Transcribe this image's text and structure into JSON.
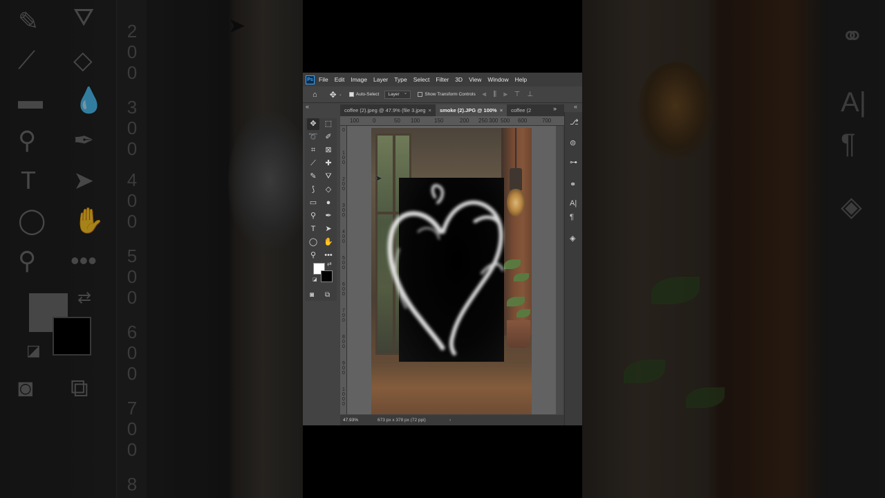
{
  "app": {
    "name": "Photoshop",
    "logo_text": "Ps"
  },
  "menu": [
    "File",
    "Edit",
    "Image",
    "Layer",
    "Type",
    "Select",
    "Filter",
    "3D",
    "View",
    "Window",
    "Help"
  ],
  "options_bar": {
    "auto_select_label": "Auto-Select",
    "auto_select_checked": true,
    "target_value": "Layer",
    "transform_controls_label": "Show Transform Controls",
    "transform_controls_checked": false
  },
  "tabs": [
    {
      "label": "coffee (2).jpeg @ 47.9% (file 3.jpeg",
      "active": false
    },
    {
      "label": "smoke (2).JPG @ 100%",
      "active": true
    },
    {
      "label": "coffee (2",
      "active": false
    }
  ],
  "ruler_top": [
    "100",
    "0",
    "50",
    "100",
    "150",
    "200",
    "250",
    "300",
    "500",
    "600",
    "700"
  ],
  "ruler_left": [
    "0",
    "1\n0\n0",
    "2\n0\n0",
    "3\n0\n0",
    "4\n0\n0",
    "5\n0\n0",
    "6\n0\n0",
    "7\n0\n0",
    "8\n0\n0",
    "9\n0\n0",
    "1\n0\n0\n0"
  ],
  "status": {
    "zoom": "47.93%",
    "dimensions": "673 px x 378 px (72 ppi)"
  },
  "tools": [
    "move-tool",
    "marquee-tool",
    "lasso-tool",
    "quick-selection-tool",
    "crop-tool",
    "frame-tool",
    "eyedropper-tool",
    "healing-tool",
    "brush-tool",
    "clone-stamp-tool",
    "history-brush-tool",
    "eraser-tool",
    "gradient-tool",
    "blur-tool",
    "dodge-tool",
    "pen-tool",
    "type-tool",
    "path-selection-tool",
    "ellipse-tool",
    "hand-tool",
    "zoom-tool",
    "more-tools"
  ],
  "colors": {
    "foreground": "#ffffff",
    "background": "#000000",
    "ui_dark": "#3c3c3c",
    "ui_mid": "#434343"
  },
  "background_ruler": [
    "2\n0\n0",
    "3\n0\n0",
    "4\n0\n0",
    "5\n0\n0",
    "6\n0\n0",
    "7\n0\n0",
    "8"
  ]
}
